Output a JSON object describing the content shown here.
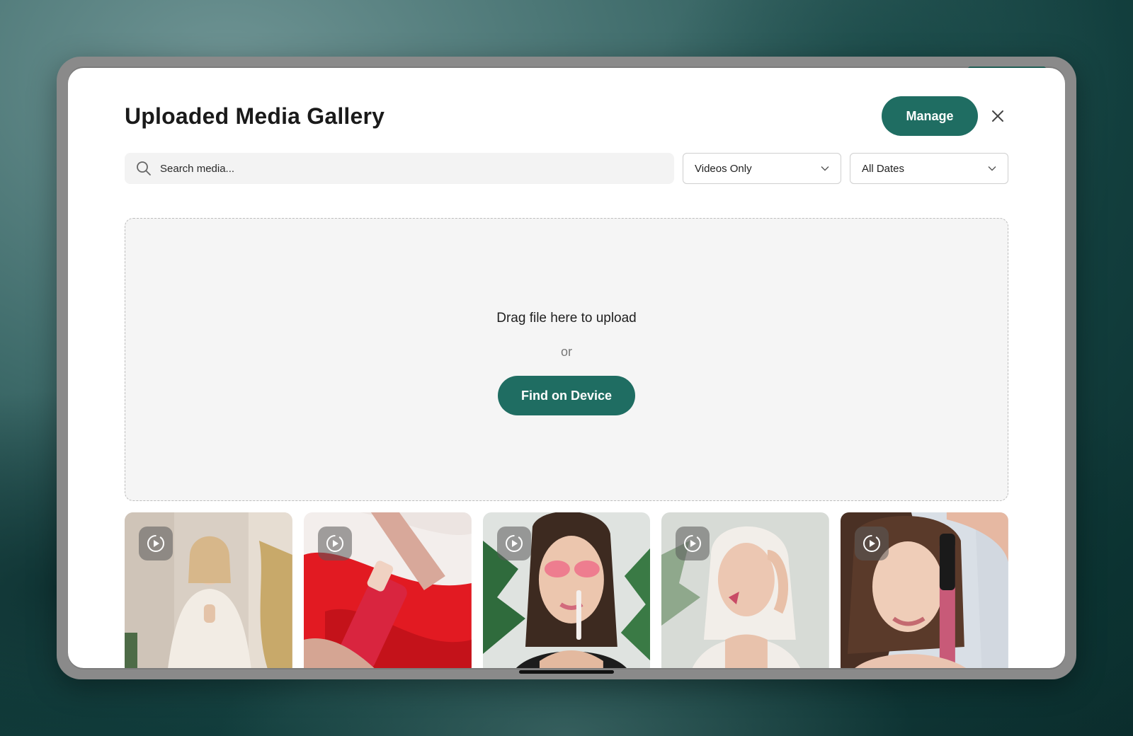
{
  "modal": {
    "title": "Uploaded Media Gallery",
    "manage_label": "Manage",
    "close_icon": "close-icon"
  },
  "search": {
    "placeholder": "Search media...",
    "icon": "search-icon"
  },
  "filters": {
    "type": {
      "selected": "Videos Only",
      "icon": "chevron-down-icon"
    },
    "date": {
      "selected": "All Dates",
      "icon": "chevron-down-icon"
    }
  },
  "dropzone": {
    "title": "Drag file here to upload",
    "or_text": "or",
    "button_label": "Find on Device"
  },
  "media": [
    {
      "type": "video",
      "icon": "play-circle-icon"
    },
    {
      "type": "video",
      "icon": "play-circle-icon"
    },
    {
      "type": "video",
      "icon": "play-circle-icon"
    },
    {
      "type": "video",
      "icon": "play-circle-icon"
    },
    {
      "type": "video",
      "icon": "play-circle-icon"
    }
  ],
  "colors": {
    "accent": "#1f6d62",
    "dropzone_bg": "#f5f5f5",
    "search_bg": "#f3f3f3"
  }
}
